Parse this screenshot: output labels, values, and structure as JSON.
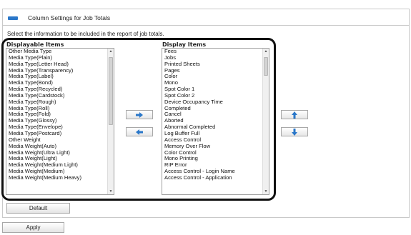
{
  "header": {
    "title": "Column Settings for Job Totals"
  },
  "instruction": "Select the information to be included in the report of job totals.",
  "displayable": {
    "heading": "Displayable Items",
    "items": [
      "Other Media Type",
      "Media Type(Plain)",
      "Media Type(Letter Head)",
      "Media Type(Transparency)",
      "Media Type(Label)",
      "Media Type(Bond)",
      "Media Type(Recycled)",
      "Media Type(Cardstock)",
      "Media Type(Rough)",
      "Media Type(Roll)",
      "Media Type(Fold)",
      "Media Type(Glossy)",
      "Media Type(Envelope)",
      "Media Type(Postcard)",
      "Other Weight",
      "Media Weight(Auto)",
      "Media Weight(Ultra Light)",
      "Media Weight(Light)",
      "Media Weight(Medium Light)",
      "Media Weight(Medium)",
      "Media Weight(Medium Heavy)"
    ]
  },
  "display": {
    "heading": "Display Items",
    "items": [
      "Fees",
      "Jobs",
      "Printed Sheets",
      "Pages",
      "Color",
      "Mono",
      "Spot Color 1",
      "Spot Color 2",
      "Device Occupancy Time",
      "Completed",
      "Cancel",
      "Aborted",
      "Abnormal Completed",
      "Log Buffer Full",
      "Access Control",
      "Memory Over Flow",
      "Color Control",
      "Mono Printing",
      "RIP Error",
      "Access Control - Login Name",
      "Access Control - Application"
    ]
  },
  "buttons": {
    "default_label": "Default",
    "apply_label": "Apply"
  },
  "icons": {
    "add": "arrow-right-icon",
    "remove": "arrow-left-icon",
    "move_up": "arrow-up-icon",
    "move_down": "arrow-down-icon",
    "accent": "#2a77c9"
  }
}
